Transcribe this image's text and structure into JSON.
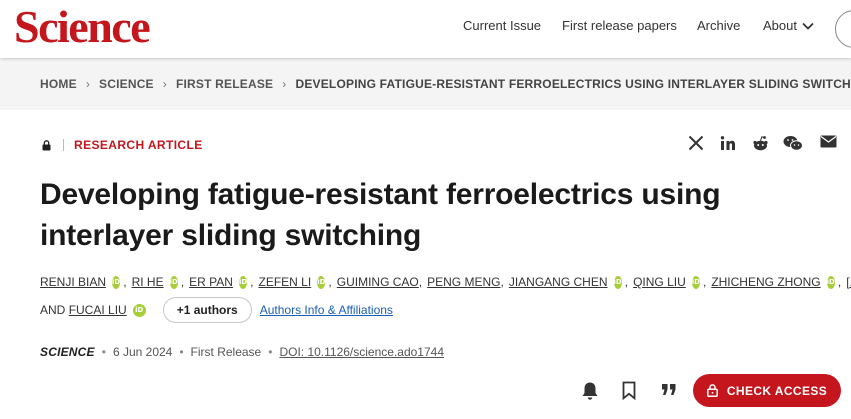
{
  "header": {
    "logo": "Science",
    "nav": [
      "Current Issue",
      "First release papers",
      "Archive",
      "About"
    ]
  },
  "breadcrumb": [
    "HOME",
    "SCIENCE",
    "FIRST RELEASE",
    "DEVELOPING FATIGUE-RESISTANT FERROELECTRICS USING INTERLAYER SLIDING SWITCHING"
  ],
  "article": {
    "type": "RESEARCH ARTICLE",
    "title": "Developing fatigue-resistant ferroelectrics using interlayer sliding switching",
    "authors_line1": [
      "RENJI BIAN",
      "RI HE",
      "ER PAN",
      "ZEFEN LI",
      "GUIMING CAO",
      "PENG MENG",
      "JIANGANG CHEN",
      "QING LIU",
      "ZHICHENG ZHONG"
    ],
    "ellipsis": "[...]",
    "and_label": "AND",
    "last_author": "FUCAI LIU",
    "more_authors": "+1 authors",
    "affiliations_link": "Authors Info & Affiliations",
    "journal": "SCIENCE",
    "date": "6 Jun 2024",
    "release": "First Release",
    "doi": "DOI: 10.1126/science.ado1744"
  },
  "share_icons": [
    "x-icon",
    "linkedin-icon",
    "reddit-icon",
    "wechat-icon",
    "email-icon"
  ],
  "actions": {
    "check_access": "CHECK ACCESS"
  },
  "colors": {
    "brand": "#c4161c",
    "orcid": "#a6ce39",
    "link": "#1a5fb4"
  }
}
